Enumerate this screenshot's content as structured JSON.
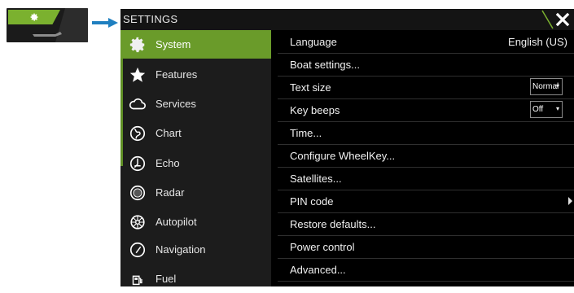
{
  "window": {
    "title": "SETTINGS"
  },
  "sidebar": {
    "items": [
      {
        "label": "System",
        "icon": "gear-icon",
        "active": true
      },
      {
        "label": "Features",
        "icon": "star-icon"
      },
      {
        "label": "Services",
        "icon": "cloud-icon"
      },
      {
        "label": "Chart",
        "icon": "globe-icon"
      },
      {
        "label": "Echo",
        "icon": "echo-icon"
      },
      {
        "label": "Radar",
        "icon": "radar-icon"
      },
      {
        "label": "Autopilot",
        "icon": "helm-icon"
      },
      {
        "label": "Navigation",
        "icon": "compass-icon"
      },
      {
        "label": "Fuel",
        "icon": "fuel-icon"
      }
    ]
  },
  "settings": {
    "language": {
      "label": "Language",
      "value": "English (US)"
    },
    "boat": {
      "label": "Boat settings..."
    },
    "text_size": {
      "label": "Text size",
      "value": "Normal"
    },
    "key_beeps": {
      "label": "Key beeps",
      "value": "Off"
    },
    "time": {
      "label": "Time..."
    },
    "wheelkey": {
      "label": "Configure WheelKey..."
    },
    "satellites": {
      "label": "Satellites..."
    },
    "pin": {
      "label": "PIN code"
    },
    "restore": {
      "label": "Restore defaults..."
    },
    "power": {
      "label": "Power control"
    },
    "advanced": {
      "label": "Advanced..."
    }
  },
  "colors": {
    "accent": "#6a9b2a",
    "arrow": "#1f7fc0"
  }
}
